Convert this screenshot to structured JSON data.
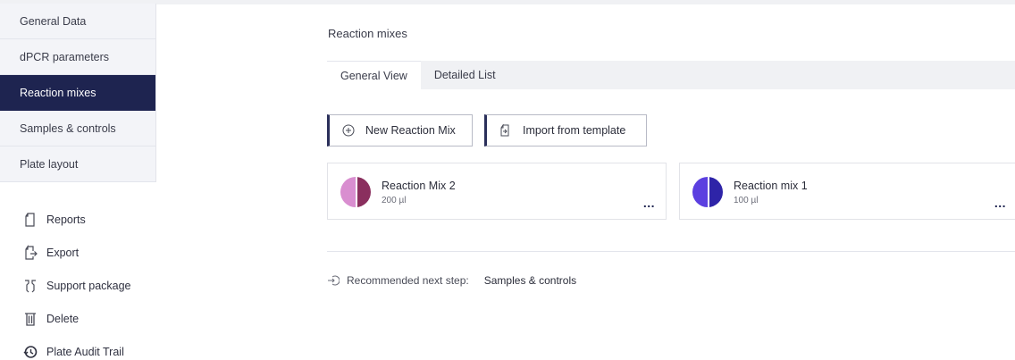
{
  "sidebar": {
    "nav_items": [
      {
        "label": "General Data"
      },
      {
        "label": "dPCR parameters"
      },
      {
        "label": "Reaction mixes",
        "active": true
      },
      {
        "label": "Samples & controls"
      },
      {
        "label": "Plate layout"
      }
    ],
    "actions": [
      {
        "label": "Reports",
        "icon": "document-icon"
      },
      {
        "label": "Export",
        "icon": "export-icon"
      },
      {
        "label": "Support package",
        "icon": "support-package-icon"
      },
      {
        "label": "Delete",
        "icon": "trash-icon"
      },
      {
        "label": "Plate Audit Trail",
        "icon": "history-icon"
      }
    ]
  },
  "main": {
    "section_title": "Reaction mixes",
    "tabs": [
      {
        "label": "General View",
        "active": true
      },
      {
        "label": "Detailed List"
      }
    ],
    "buttons": {
      "new_mix": "New Reaction Mix",
      "import_template": "Import from template"
    },
    "mixes": [
      {
        "name": "Reaction Mix 2",
        "volume": "200 µl",
        "colors": [
          "#d98ed0",
          "#8a2f5e"
        ]
      },
      {
        "name": "Reaction mix 1",
        "volume": "100 µl",
        "colors": [
          "#5b3fe0",
          "#2e24a8"
        ]
      }
    ],
    "more_label": "...",
    "next_step": {
      "label": "Recommended next step:",
      "link": "Samples & controls"
    }
  },
  "colors": {
    "active_nav": "#1e2450",
    "sidebar_bg": "#f3f4f8",
    "tab_bar_bg": "#f0f1f4"
  }
}
